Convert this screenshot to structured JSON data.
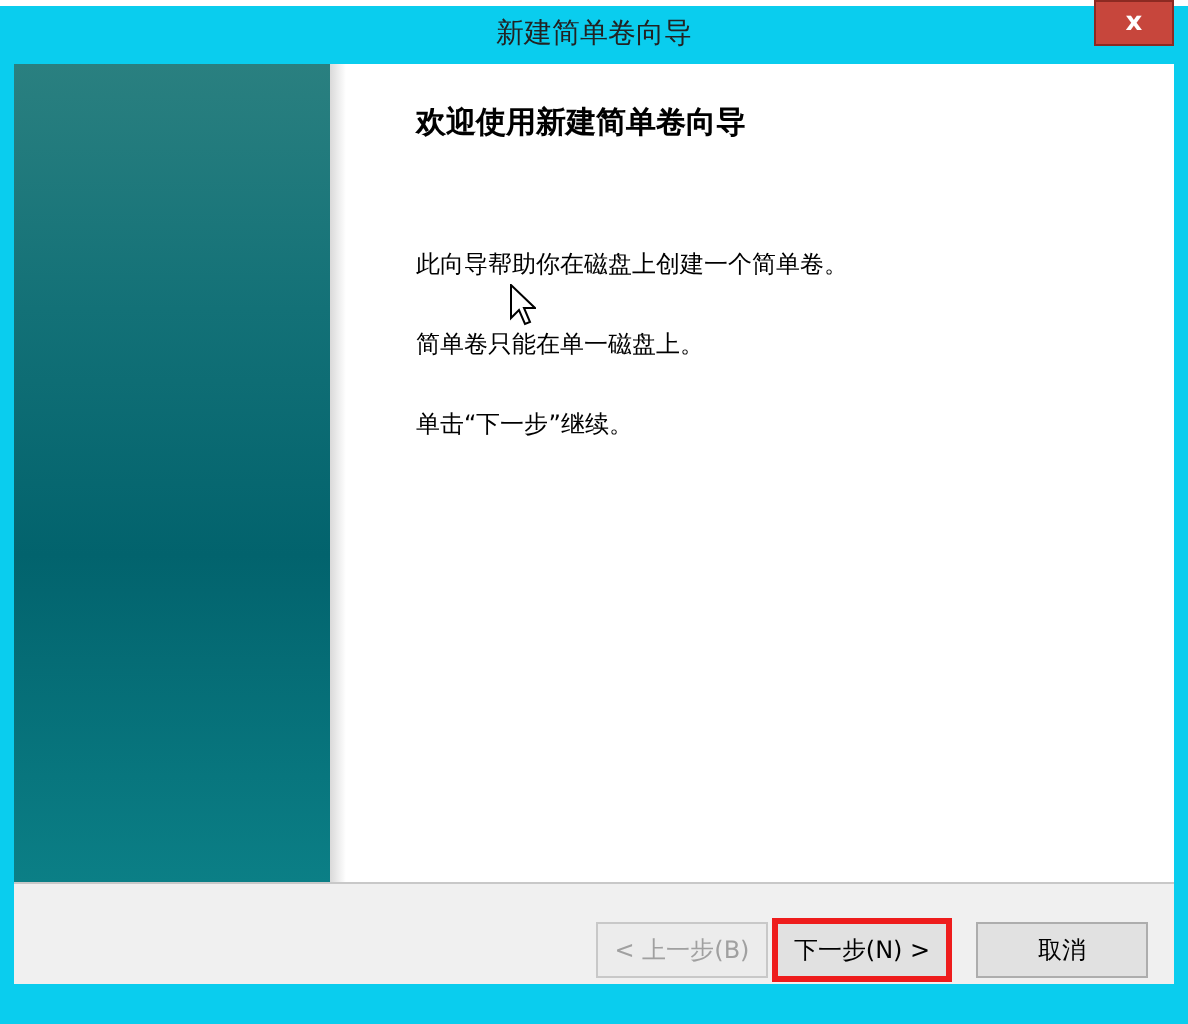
{
  "window": {
    "title": "新建简单卷向导",
    "close_label": "x"
  },
  "page": {
    "heading": "欢迎使用新建简单卷向导",
    "paragraphs": [
      "此向导帮助你在磁盘上创建一个简单卷。",
      "简单卷只能在单一磁盘上。",
      "单击“下一步”继续。"
    ]
  },
  "buttons": [
    {
      "label": "< 上一步(B)",
      "disabled": true,
      "highlighted": false
    },
    {
      "label": "下一步(N) >",
      "disabled": false,
      "highlighted": true
    },
    {
      "label": "取消",
      "disabled": false,
      "highlighted": false
    }
  ]
}
